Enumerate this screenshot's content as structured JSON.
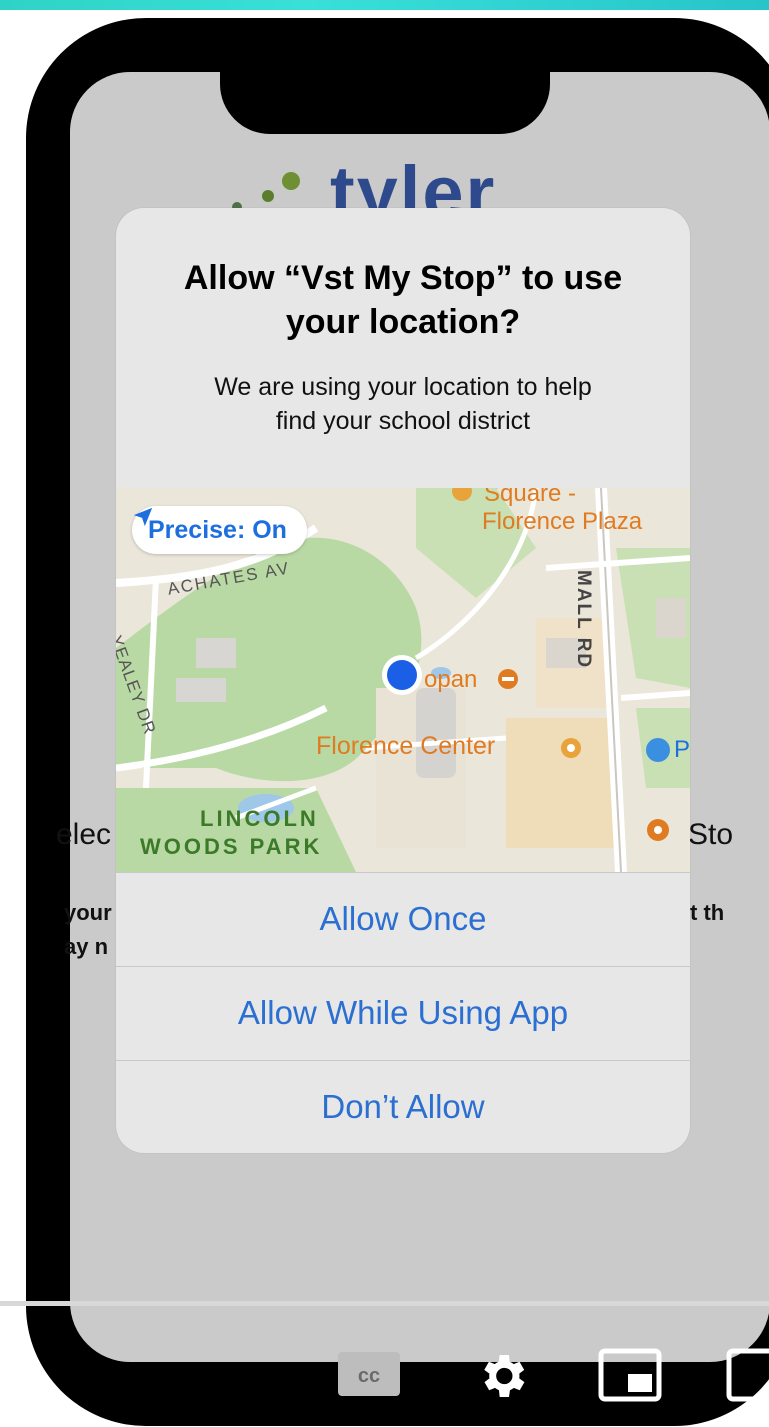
{
  "background_app": {
    "logo_text": "tyler",
    "partial_text_left_1": "elec",
    "partial_text_left_2": "your",
    "partial_text_left_3": "ay n",
    "partial_text_right_1": "Sto",
    "partial_text_right_2": "t th"
  },
  "alert": {
    "title_line1": "Allow “Vst My Stop” to use",
    "title_line2": "your location?",
    "message_line1": "We are using your location to help",
    "message_line2": "find your school district",
    "precise_label": "Precise: On",
    "buttons": {
      "allow_once": "Allow Once",
      "allow_while_using": "Allow While Using App",
      "dont_allow": "Don’t Allow"
    }
  },
  "map": {
    "labels": {
      "square_florence_plaza_line1": "Square -",
      "square_florence_plaza_line2": "Florence Plaza",
      "achates": "ACHATES AV",
      "mall_rd": "MALL RD",
      "yealey_dr": "YEALEY DR",
      "opan": "opan",
      "florence_center": "Florence Center",
      "lincoln_line1": "LINCOLN",
      "lincoln_line2": "WOODS PARK",
      "partial_p": "P"
    }
  },
  "video_controls": {
    "cc_icon": "cc-icon",
    "settings_icon": "gear-icon",
    "miniplayer_icon": "miniplayer-icon",
    "theater_icon": "theater-icon"
  },
  "colors": {
    "accent_blue": "#2a6fd1",
    "map_park_green": "#b7d8a3",
    "map_poi_orange": "#e07b22",
    "location_dot": "#1b5fe6"
  }
}
